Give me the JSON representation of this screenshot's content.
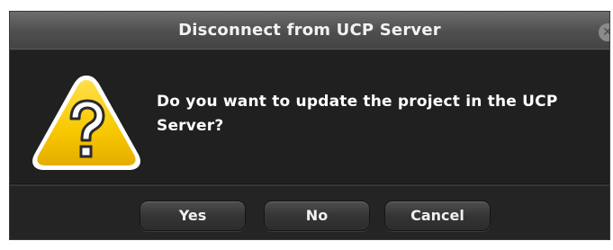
{
  "dialog": {
    "title": "Disconnect from UCP Server",
    "close_icon": "close-icon",
    "message": "Do you want to update the project in the UCP Server?",
    "icon": "warning-question-icon"
  },
  "buttons": {
    "yes_label": "Yes",
    "no_label": "No",
    "cancel_label": "Cancel"
  },
  "colors": {
    "dialog_background": "#202020",
    "titlebar": "#555555",
    "icon_yellow": "#f4c400",
    "text": "#ffffff"
  }
}
